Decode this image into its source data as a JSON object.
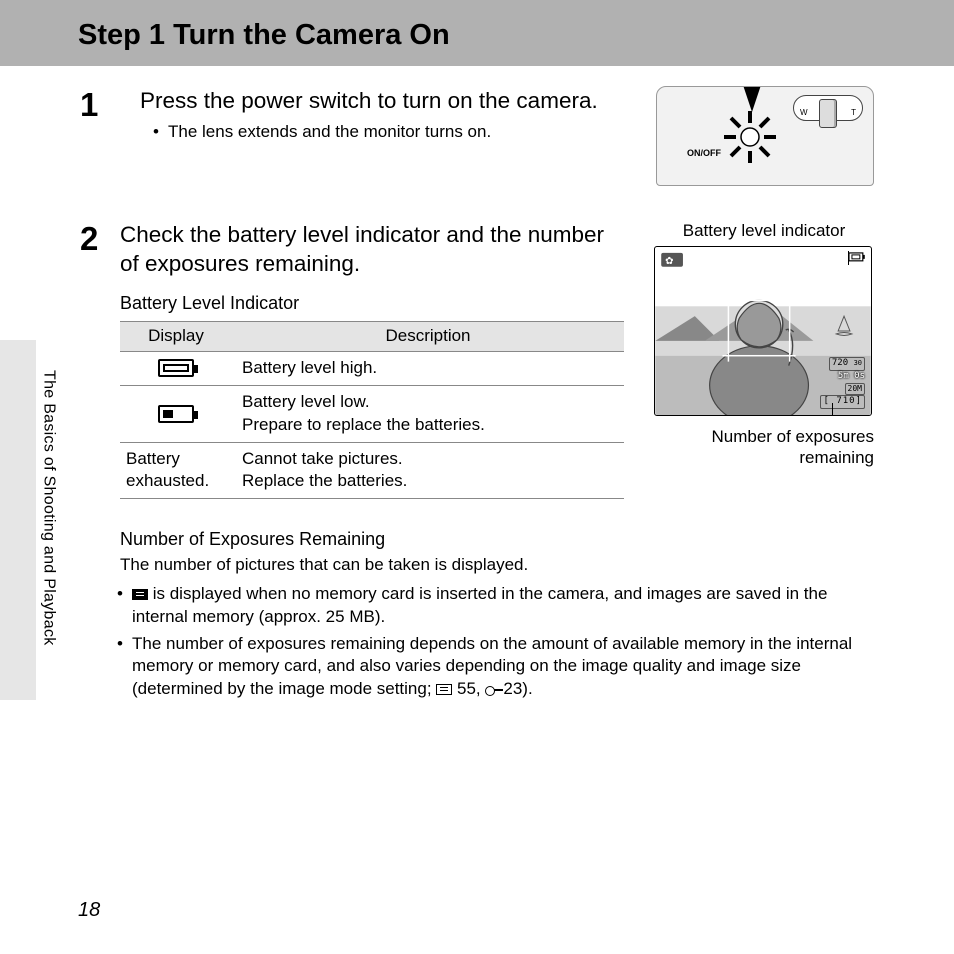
{
  "title": "Step 1 Turn the Camera On",
  "side_text": "The Basics of Shooting and Playback",
  "page_number": "18",
  "step1": {
    "num": "1",
    "main": "Press the power switch to turn on the camera.",
    "bullet1": "The lens extends and the monitor turns on.",
    "onoff_label": "ON/OFF",
    "dial_left": "W",
    "dial_right": "T"
  },
  "step2": {
    "num": "2",
    "main": "Check the battery level indicator and the number of exposures remaining.",
    "battery_heading": "Battery Level Indicator",
    "th_display": "Display",
    "th_desc": "Description",
    "row1_desc": "Battery level high.",
    "row2_desc_a": "Battery level low.",
    "row2_desc_b": "Prepare to replace the batteries.",
    "row3_disp": "Battery exhausted.",
    "row3_desc_a": "Cannot take pictures.",
    "row3_desc_b": "Replace the batteries.",
    "lcd_label_top": "Battery level indicator",
    "lcd_label_bottom_a": "Number of exposures",
    "lcd_label_bottom_b": "remaining",
    "lcd_values": {
      "rec_res": "720",
      "fps": "30",
      "time": "5m 0s",
      "size": "20M",
      "exposures": "[  710]"
    },
    "exposures_heading": "Number of Exposures Remaining",
    "exposures_intro": "The number of pictures that can be taken is displayed.",
    "bullet_mem_a": " is displayed when no memory card is inserted in the camera, and images are saved in the internal memory (approx. 25 MB).",
    "bullet_dep_a": "The number of exposures remaining depends on the amount of available memory in the internal memory or memory card, and also varies depending on the image quality and image size (determined by the image mode setting; ",
    "bullet_dep_ref1": " 55, ",
    "bullet_dep_ref2": "23)."
  }
}
